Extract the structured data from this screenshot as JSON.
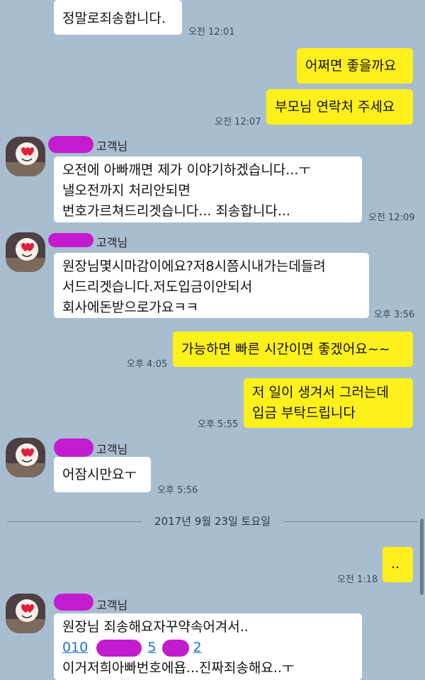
{
  "messages": {
    "m1": {
      "text": "정말로죄송합니다.",
      "time": "오전 12:01"
    },
    "m2": {
      "text": "어쩌면 좋을까요"
    },
    "m3": {
      "text": "부모님 연락처 주세요",
      "time": "오전 12:07"
    },
    "m4": {
      "sender": "고객님",
      "line1": "오전에 아빠깨면 제가 이야기하겠습니다...ㅜ",
      "line2": "낼오전까지 처리안되면",
      "line3": "번호가르쳐드리겟습니다... 죄송합니다...",
      "time": "오전 12:09"
    },
    "m5": {
      "sender": "고객님",
      "line1": "원장님몇시마감이에요?저8시쯤시내가는데들려",
      "line2": "서드리겟습니다.저도입금이안되서",
      "line3": "회사에돈받으로가요ㅋㅋ",
      "time": "오후 3:56"
    },
    "m6": {
      "text": "가능하면 빠른 시간이면 좋겠어요~~",
      "time": "오후 4:05"
    },
    "m7": {
      "line1": "저 일이 생겨서 그러는데",
      "line2": "입금 부탁드립니다",
      "time": "오후 5:55"
    },
    "m8": {
      "sender": "고객님",
      "text": "어잠시만요ㅜ",
      "time": "오후 5:56"
    },
    "date_divider": "2017년 9월 23일 토요일",
    "m9": {
      "text": "..",
      "time": "오전 1:18"
    },
    "m10": {
      "sender": "고객님",
      "line1": "원장님 죄송해요자꾸약속어겨서..",
      "phone_a": "010",
      "phone_b": "5",
      "phone_c": "2",
      "line3": "이거저희아빠번호에욥...진짜죄송해요..ㅜ"
    }
  },
  "colors": {
    "background": "#a9bdd0",
    "my_bubble": "#fef01b",
    "their_bubble": "#ffffff",
    "redaction": "#c21bd0"
  }
}
